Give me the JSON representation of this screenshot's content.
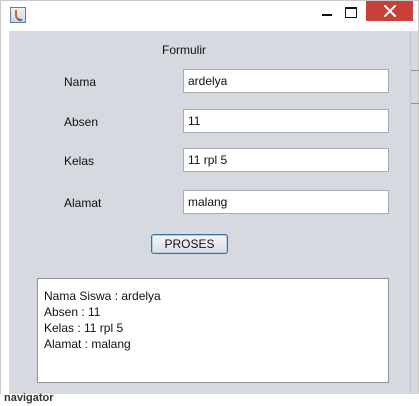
{
  "form": {
    "title": "Formulir",
    "fields": [
      {
        "label": "Nama",
        "value": "ardelya"
      },
      {
        "label": "Absen",
        "value": "11"
      },
      {
        "label": "Kelas",
        "value": "11 rpl 5"
      },
      {
        "label": "Alamat",
        "value": "malang"
      }
    ],
    "button_label": "PROSES"
  },
  "output": {
    "lines": [
      "Nama Siswa : ardelya",
      "Absen : 11",
      "Kelas : 11 rpl 5",
      "Alamat : malang"
    ]
  },
  "background": {
    "partial_label": "navigator"
  },
  "colors": {
    "panel": "#d6d9df",
    "close_button": "#c8403a",
    "button_border": "#3a6ea5"
  },
  "icons": {
    "app": "java-app-icon",
    "minimize": "minimize-icon",
    "maximize": "maximize-icon",
    "close": "close-icon"
  }
}
